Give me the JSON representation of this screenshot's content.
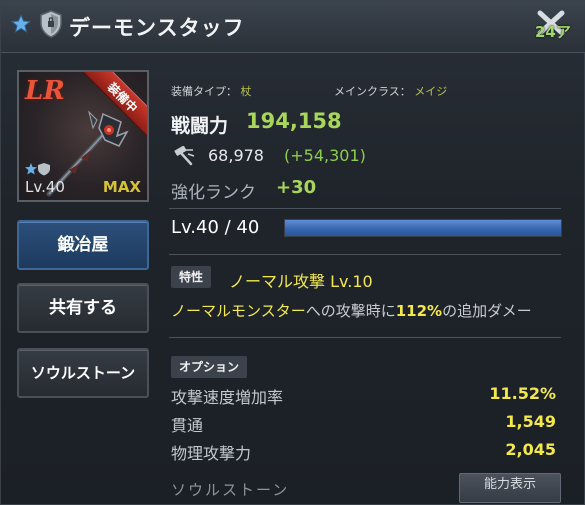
{
  "header": {
    "title": "デーモンスタッフ",
    "timer": "24ア"
  },
  "item": {
    "rarity": "LR",
    "equipped_badge": "装備中",
    "level": "Lv.40",
    "max_label": "MAX"
  },
  "side_buttons": {
    "smith": "鍛冶屋",
    "share": "共有する",
    "soulstone": "ソウルストーン"
  },
  "meta": {
    "equip_type_label": "装備タイプ：",
    "equip_type_value": "杖",
    "main_class_label": "メインクラス：",
    "main_class_value": "メイジ"
  },
  "stats": {
    "power_label": "戦闘力",
    "power_value": "194,158",
    "sub_value": "68,978",
    "sub_bonus": "(+54,301)",
    "rank_label": "強化ランク",
    "rank_value": "+30"
  },
  "level": {
    "text": "Lv.40 / 40",
    "progress": 1.0
  },
  "trait": {
    "tag": "特性",
    "name": "ノーマル攻撃 Lv.10",
    "desc_highlight1": "ノーマルモンスター",
    "desc_mid": "への攻撃時に",
    "desc_highlight2": "112%",
    "desc_tail": "の追加ダメー"
  },
  "options": {
    "tag": "オプション",
    "rows": [
      {
        "label": "攻撃速度増加率",
        "value": "11.52%"
      },
      {
        "label": "貫通",
        "value": "1,549"
      },
      {
        "label": "物理攻撃力",
        "value": "2,045"
      }
    ]
  },
  "footer": {
    "soulstone_heading": "ソウルストーン",
    "ability_button": "能力表示"
  },
  "colors": {
    "accent_green": "#a7d65a",
    "highlight_yellow": "#f3e94a",
    "bar_blue": "#3564ad",
    "rarity_red": "#e8553a"
  }
}
